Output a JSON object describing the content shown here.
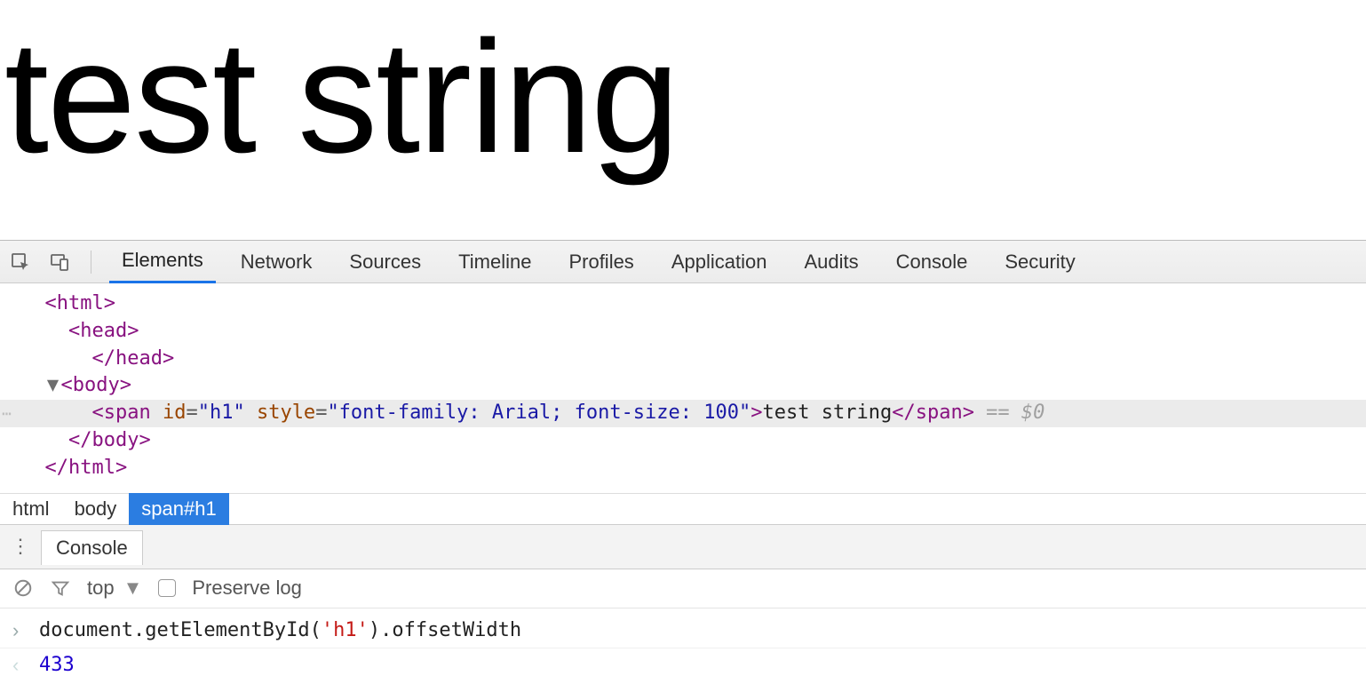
{
  "page": {
    "rendered_text": "test string"
  },
  "devtools": {
    "tabs": [
      "Elements",
      "Network",
      "Sources",
      "Timeline",
      "Profiles",
      "Application",
      "Audits",
      "Console",
      "Security"
    ],
    "active_tab_index": 0
  },
  "dom": {
    "l0": "<html>",
    "l1_open": "<head>",
    "l1_close": "</head>",
    "l2": "<body>",
    "selected": {
      "tag_open": "<span",
      "attr_id_name": "id",
      "attr_id_val": "\"h1\"",
      "attr_style_name": "style",
      "attr_style_val": "\"font-family: Arial; font-size: 100\"",
      "tag_open_end": ">",
      "text": "test string",
      "tag_close": "</span>",
      "trailer": " == $0"
    },
    "l2_close": "</body>",
    "l0_close": "</html>"
  },
  "breadcrumbs": [
    "html",
    "body",
    "span#h1"
  ],
  "breadcrumbs_active_index": 2,
  "drawer": {
    "tab_label": "Console",
    "toolbar": {
      "context_label": "top",
      "preserve_log_label": "Preserve log"
    }
  },
  "console": {
    "input_prefix": "document.getElementById(",
    "input_arg": "'h1'",
    "input_suffix": ").offsetWidth",
    "output": "433"
  }
}
